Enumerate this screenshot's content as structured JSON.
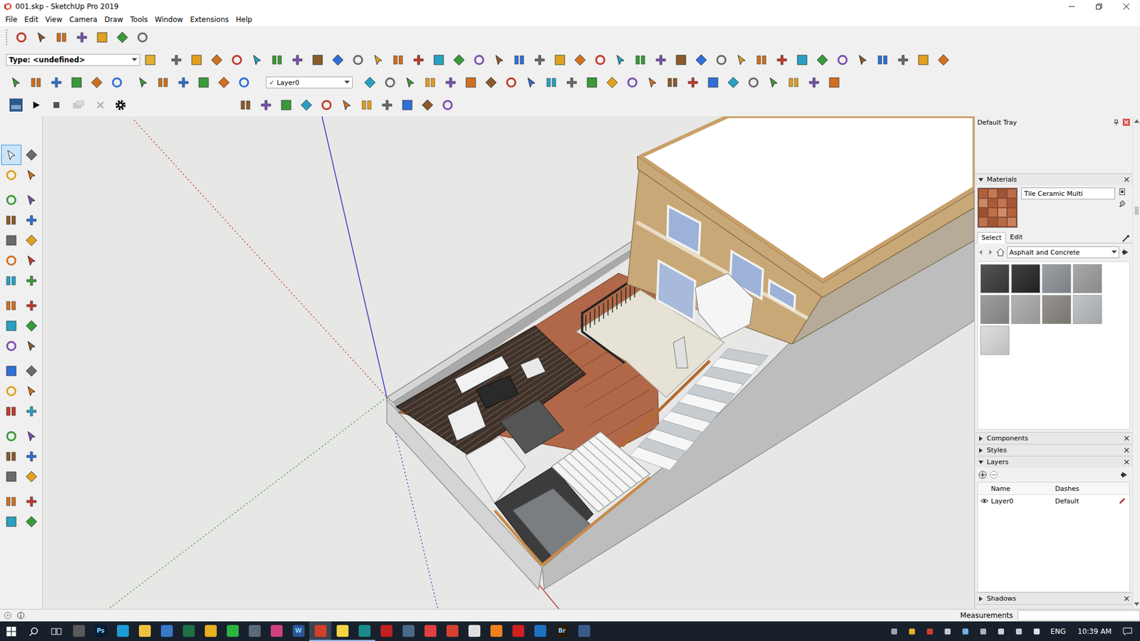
{
  "window": {
    "title": "001.skp - SketchUp Pro 2019"
  },
  "menu": [
    "File",
    "Edit",
    "View",
    "Camera",
    "Draw",
    "Tools",
    "Window",
    "Extensions",
    "Help"
  ],
  "toolbar": {
    "type_select": "Type: <undefined>",
    "layer_select": {
      "check": "✓",
      "value": "Layer0"
    }
  },
  "tool_palette": {
    "groups": [
      [
        {
          "selected": true
        },
        {
          "selected": false
        },
        {
          "selected": false
        },
        {
          "selected": false
        }
      ],
      [
        {
          "selected": false
        },
        {
          "selected": false
        },
        {
          "selected": false
        },
        {
          "selected": false
        },
        {
          "selected": false
        },
        {
          "selected": false
        },
        {
          "selected": false
        },
        {
          "selected": false
        },
        {
          "selected": false
        },
        {
          "selected": false
        }
      ],
      [
        {
          "selected": false
        },
        {
          "selected": false
        },
        {
          "selected": false
        },
        {
          "selected": false
        },
        {
          "selected": false
        },
        {
          "selected": false
        }
      ],
      [
        {
          "selected": false
        },
        {
          "selected": false
        },
        {
          "selected": false
        },
        {
          "selected": false
        },
        {
          "selected": false
        },
        {
          "selected": false
        }
      ],
      [
        {
          "selected": false
        },
        {
          "selected": false
        },
        {
          "selected": false
        },
        {
          "selected": false
        },
        {
          "selected": false
        },
        {
          "selected": false
        }
      ],
      [
        {
          "selected": false
        },
        {
          "selected": false
        },
        {
          "selected": false
        },
        {
          "selected": false
        }
      ]
    ]
  },
  "tray": {
    "title": "Default Tray",
    "materials": {
      "title": "Materials",
      "expanded": true,
      "name": "Tile Ceramic Multi",
      "tabs": [
        {
          "label": "Select",
          "selected": true
        },
        {
          "label": "Edit",
          "selected": false
        }
      ],
      "library": "Asphalt and Concrete",
      "swatches": [
        {
          "color": "#3d3b3e"
        },
        {
          "color": "#262628"
        },
        {
          "color": "#8e9398"
        },
        {
          "color": "#9b9d9f"
        },
        {
          "color": "#909090"
        },
        {
          "color": "#aaaba9"
        },
        {
          "color": "#8a857f"
        },
        {
          "color": "#babdc1"
        },
        {
          "color": "#d9d9d9"
        }
      ]
    },
    "collapsed_panels": [
      {
        "title": "Components",
        "expanded": false
      },
      {
        "title": "Styles",
        "expanded": false
      }
    ],
    "layers": {
      "title": "Layers",
      "expanded": true,
      "columns": [
        "Name",
        "Dashes"
      ],
      "rows": [
        {
          "name": "Layer0",
          "dashes": "Default",
          "visible": true
        }
      ]
    },
    "bottom_panels": [
      {
        "title": "Shadows",
        "expanded": false
      }
    ]
  },
  "status_bar": {
    "measurements_label": "Measurements",
    "measurements_value": ""
  },
  "taskbar": {
    "apps": [
      {
        "label": "",
        "color": "#5a5a5a",
        "running": false,
        "selected": false
      },
      {
        "label": "Ps",
        "color": "#001e36",
        "running": false,
        "selected": false
      },
      {
        "label": "",
        "color": "#1e9bd7",
        "running": false,
        "selected": false
      },
      {
        "label": "",
        "color": "#f0c040",
        "running": false,
        "selected": false
      },
      {
        "label": "",
        "color": "#3a78c8",
        "running": false,
        "selected": false
      },
      {
        "label": "",
        "color": "#1d7044",
        "running": false,
        "selected": false
      },
      {
        "label": "",
        "color": "#e8b020",
        "running": false,
        "selected": false
      },
      {
        "label": "",
        "color": "#2bb540",
        "running": false,
        "selected": false
      },
      {
        "label": "",
        "color": "#5a6a7a",
        "running": false,
        "selected": false
      },
      {
        "label": "",
        "color": "#d04080",
        "running": false,
        "selected": false
      },
      {
        "label": "W",
        "color": "#2b579a",
        "running": false,
        "selected": false
      },
      {
        "label": "",
        "color": "#d0402a",
        "running": true,
        "selected": true
      },
      {
        "label": "",
        "color": "#f5d442",
        "running": true,
        "selected": false
      },
      {
        "label": "",
        "color": "#1a8a8a",
        "running": true,
        "selected": false
      },
      {
        "label": "",
        "color": "#c02020",
        "running": false,
        "selected": false
      },
      {
        "label": "",
        "color": "#4a6a8a",
        "running": false,
        "selected": false
      },
      {
        "label": "",
        "color": "#e04040",
        "running": false,
        "selected": false
      },
      {
        "label": "",
        "color": "#d84030",
        "running": false,
        "selected": false
      },
      {
        "label": "",
        "color": "#e0e0e0",
        "running": false,
        "selected": false
      },
      {
        "label": "",
        "color": "#f08020",
        "running": false,
        "selected": false
      },
      {
        "label": "",
        "color": "#d02020",
        "running": false,
        "selected": false
      },
      {
        "label": "",
        "color": "#2070c0",
        "running": false,
        "selected": false
      },
      {
        "label": "Br",
        "color": "#2a1a0a",
        "running": false,
        "selected": false
      },
      {
        "label": "",
        "color": "#3a5a8a",
        "running": false,
        "selected": false
      }
    ],
    "language": "ENG",
    "time": "10:39 AM"
  }
}
